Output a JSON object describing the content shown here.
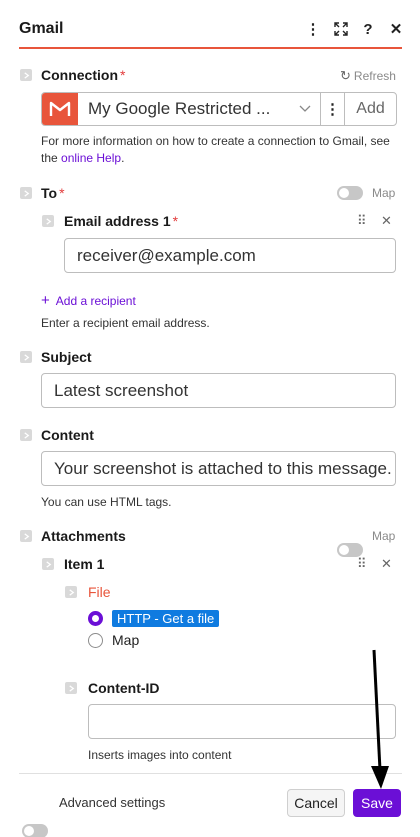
{
  "header": {
    "title": "Gmail",
    "icon_more": "⋮",
    "icon_expand": "⤢",
    "icon_help": "?",
    "icon_close": "✕"
  },
  "connection": {
    "label": "Connection",
    "required_mark": "*",
    "refresh_label": "Refresh",
    "selected_value": "My Google Restricted ...",
    "add_label": "Add",
    "help_prefix": "For more information on how to create a connection to Gmail, see the ",
    "help_link": "online Help",
    "help_suffix": "."
  },
  "to": {
    "label": "To",
    "required_mark": "*",
    "map_label": "Map",
    "email_item": {
      "label": "Email address 1",
      "required_mark": "*",
      "value": "receiver@example.com"
    },
    "add_recipient_label": "Add a recipient",
    "help": "Enter a recipient email address."
  },
  "subject": {
    "label": "Subject",
    "value": "Latest screenshot"
  },
  "content": {
    "label": "Content",
    "value": "Your screenshot is attached to this message.",
    "help": "You can use HTML tags."
  },
  "attachments": {
    "label": "Attachments",
    "map_label": "Map",
    "item": {
      "label": "Item 1",
      "file_label": "File",
      "options": [
        "HTTP - Get a file",
        "Map"
      ],
      "selected_option": "HTTP - Get a file",
      "content_id_label": "Content-ID",
      "content_id_value": "",
      "content_id_help": "Inserts images into content"
    }
  },
  "footer": {
    "advanced_label": "Advanced settings",
    "cancel_label": "Cancel",
    "save_label": "Save"
  },
  "colors": {
    "accent": "#6b0fd6",
    "brand": "#e8553b",
    "chip": "#0f7be0"
  }
}
